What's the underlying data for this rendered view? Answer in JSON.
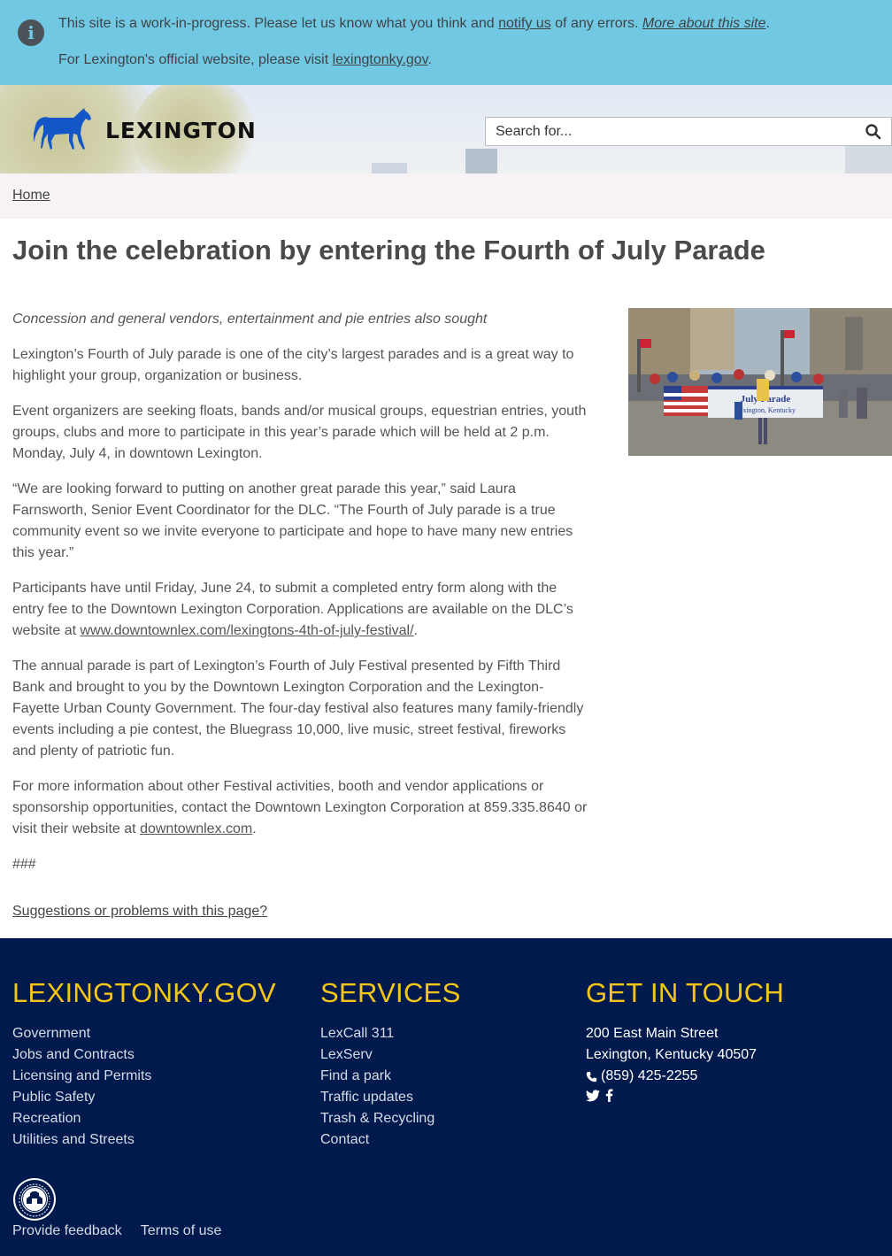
{
  "notice": {
    "prefix": "This site is a work-in-progress. Please let us know what you think and ",
    "notify_link": "notify us",
    "middle": " of any errors. ",
    "about_link": "More about this site",
    "suffix": ".",
    "line2_prefix": "For Lexington's official website, please visit ",
    "official_link": "lexingtonky.gov",
    "line2_suffix": ".",
    "icon": "info-icon"
  },
  "header": {
    "logo_text": "LEXINGTON",
    "logo_icon": "horse-icon",
    "search_placeholder": "Search for...",
    "search_icon": "search-icon"
  },
  "breadcrumb": {
    "home": "Home"
  },
  "article": {
    "title": "Join the celebration by entering the Fourth of July Parade",
    "lede": "Concession and general vendors, entertainment and pie entries also sought",
    "p1": "Lexington’s Fourth of July parade is one of the city’s largest parades and is a great way to highlight your group, organization or business.",
    "p2": "Event organizers are seeking floats, bands and/or musical groups, equestrian entries, youth groups, clubs and more to participate in this year’s parade which will be held at 2 p.m. Monday, July 4, in downtown Lexington.",
    "p3": "“We are looking forward to putting on another great parade this year,” said Laura Farnsworth, Senior Event Coordinator for the DLC. “The Fourth of July parade is a true community event so we invite everyone to participate and hope to have many new entries this year.”",
    "p4_text": "Participants have until Friday, June 24, to submit a completed entry form along with the entry fee to the Downtown Lexington Corporation. Applications are available on the DLC’s website at ",
    "p4_link": "www.downtownlex.com/lexingtons-4th-of-july-festival/",
    "p4_end": ".",
    "p5": "The annual parade is part of Lexington’s Fourth of July Festival presented by Fifth Third Bank and brought to you by the Downtown Lexington Corporation and the Lexington-Fayette Urban County Government. The four-day festival also features many family-friendly events including a pie contest, the Bluegrass 10,000, live music, street festival, fireworks and plenty of patriotic fun.",
    "p6_text": "For more information about other Festival activities, booth and vendor applications or sponsorship opportunities, contact the Downtown Lexington Corporation at 859.335.8640 or visit their website at ",
    "p6_link": "downtownlex.com",
    "p6_end": ".",
    "end_mark": "###",
    "suggestions_link": "Suggestions or problems with this page?",
    "banner_text": "July Parade",
    "banner_subtext": "Lexington, Kentucky"
  },
  "footer": {
    "col1_title": "LEXINGTONKY.GOV",
    "col1_links": [
      "Government",
      "Jobs and Contracts",
      "Licensing and Permits",
      "Public Safety",
      "Recreation",
      "Utilities and Streets"
    ],
    "col2_title": "SERVICES",
    "col2_links": [
      "LexCall 311",
      "LexServ",
      "Find a park",
      "Traffic updates",
      "Trash & Recycling",
      "Contact"
    ],
    "col3_title": "GET IN TOUCH",
    "address1": "200 East Main Street",
    "address2": "Lexington, Kentucky 40507",
    "phone": "(859) 425-2255",
    "phone_icon": "phone-icon",
    "social_icons": [
      "twitter-icon",
      "facebook-icon"
    ],
    "seal_icon": "city-seal-icon",
    "feedback_link": "Provide feedback",
    "terms_link": "Terms of use"
  }
}
